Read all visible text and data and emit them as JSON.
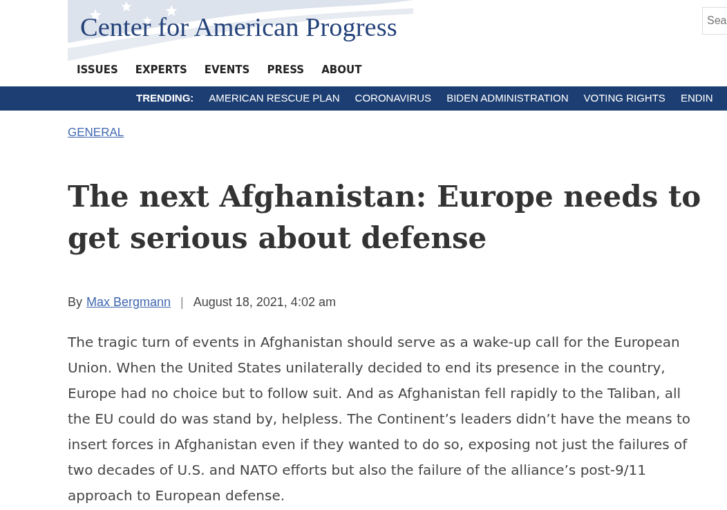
{
  "logo": {
    "text": "Center for American Progress"
  },
  "search": {
    "placeholder": "Sea"
  },
  "nav": [
    "ISSUES",
    "EXPERTS",
    "EVENTS",
    "PRESS",
    "ABOUT"
  ],
  "trending": {
    "label": "TRENDING:",
    "items": [
      "AMERICAN RESCUE PLAN",
      "CORONAVIRUS",
      "BIDEN ADMINISTRATION",
      "VOTING RIGHTS",
      "ENDIN"
    ]
  },
  "category": "GENERAL",
  "headline": "The next Afghanistan: Europe needs to get serious about defense",
  "byline": {
    "prefix": "By",
    "author": "Max Bergmann",
    "separator": "|",
    "date": "August 18, 2021, 4:02 am"
  },
  "body": [
    "The tragic turn of events in Afghanistan should serve as a wake-up call for the European Union. When the United States unilaterally decided to end its presence in the country, Europe had no choice but to follow suit. And as Afghanistan fell rapidly to the Taliban, all the EU could do was stand by, helpless. The Continent’s leaders didn’t have the means to insert forces in Afghanistan even if they wanted to do so, exposing not just the failures of two decades of U.S. and NATO efforts but also the failure of the alliance’s post-9/11 approach to European defense."
  ]
}
